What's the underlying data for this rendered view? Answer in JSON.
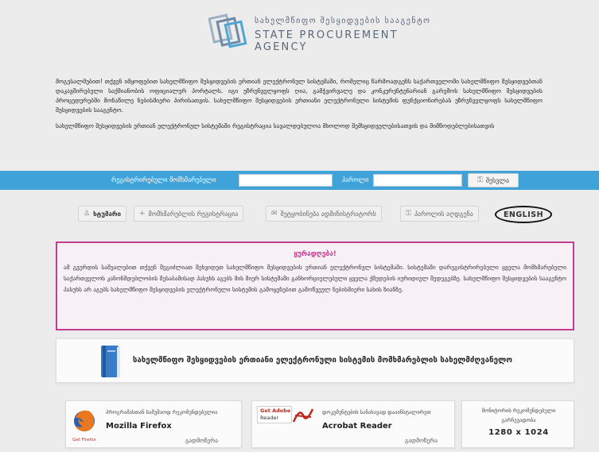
{
  "agency": {
    "name_ka": "სახელმწიფო შესყიდვების სააგენტო",
    "name_en": "STATE PROCUREMENT AGENCY"
  },
  "intro": {
    "paragraph_1": "მოგესალმებით! თქვენ იმყოფებით სახელმწიფო შესყიდვების ერთიან ელექტრონულ სისტემაში, რომელიც წარმოადგენს საქართველოში სახელმწიფო შესყიდვებთან დაკავშირებული საქმიანობის ოფიციალურ პორტალს. იგი უზრუნველყოფს ღია, გამჭვირვალე და კონკურენტუნარიან გარემოს სახელმწიფო შესყიდვების პროცედურებში მონაწილე ნებისმიერი პირისათვის. სახელმწიფო შესყიდვების ერთიანი ელექტრონული სისტემის ფუნქციონირებას უზრუნველყოფს სახელმწიფო შესყიდვების სააგენტო.",
    "paragraph_2": "სახელმწიფო შესყიდვების ერთიან ელექტრონულ სისტემაში რეგისტრაცია სავალდებულოა მხოლოდ შემსყიდველებისათვის და მიმწოდებლებისათვის"
  },
  "login": {
    "user_label": "რეგისტრირებული მომხმარებელი",
    "password_label": "პაროლი",
    "submit_label": "შესვლა",
    "user_value": "",
    "password_value": ""
  },
  "nav": {
    "home": "ხტუმარი",
    "register": "მომხმარებლის რეგისტრაცია",
    "contact_admin": "შეტყობინება ადმინისტრატორს",
    "recover_password": "პაროლის აღდგენა",
    "english": "ENGLISH"
  },
  "warning": {
    "title": "ყურადღება!",
    "text": "ამ გვერდის საშუალებით თქვენ შეგიძლიათ შეხვიდეთ სახელმწიფო შესყიდვების ერთიან ელექტრონულ სისტემაში. სისტემაში დარეგისტრირებული ყველა მომხმარებელი საქართველოს კანონმდებლობის შესაბამისად პასუხს აგებს მის მიერ სისტემაში განხორციელებული ყველა ქმედების იურიდიულ შედეგებზე. სახელმწიფო შესყიდვების სააგენტო პასუხს არ აგებს სახელმწიფო შესყიდვების ელექტრონული სისტემის გამოყენებით გამოწვეულ ნებისმიერი სახის ზიანზე."
  },
  "manual": {
    "label": "სახელმწიფო შესყიდვების ერთიანი ელექტრონული სისტემის მომხმარებლის სახელმძღვანელო"
  },
  "cards": {
    "firefox": {
      "subtitle": "პროგრამასთან სამუშაოდ რეკომენდებულია",
      "name": "Mozilla Firefox",
      "download": "გადმოწერა",
      "badge": "Get Firefox"
    },
    "acrobat": {
      "subtitle": "დოკუმენტების სანახავად დააინსტალირეთ",
      "name": "Acrobat Reader",
      "download": "გადმოწერა",
      "badge_line1": "Get Adobe",
      "badge_line2": "Reader"
    },
    "resolution": {
      "line1": "მონიტორის რეკომენდებული",
      "line2": "გარჩევადობა",
      "value": "1280 x 1024"
    }
  },
  "colors": {
    "login_bar": "#3fa2d9",
    "warning_border": "#c23d8f",
    "warning_title": "#c23d8f",
    "page_bg": "#ececec"
  }
}
